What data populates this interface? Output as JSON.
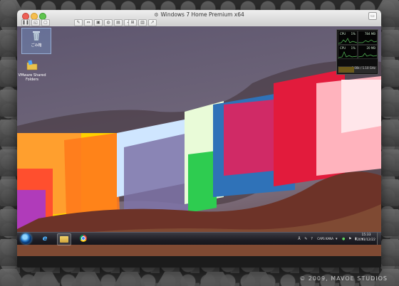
{
  "window": {
    "title": "Windows 7 Home Premium x64"
  },
  "desktop": {
    "icons": [
      {
        "label": "ごみ箱"
      },
      {
        "label": "VMware Shared Folders"
      }
    ]
  },
  "gadget": {
    "cpu_label": "CPU",
    "cpu_value": "1%",
    "mem_label": "784 MB",
    "cpu2_label": "CPU",
    "cpu2_value": "1%",
    "mem2_label": "20 MB",
    "freq": "0.00k / 1.10 GHz"
  },
  "taskbar": {
    "ime": "CAPS KANA",
    "time": "15:33",
    "date": "2013/12/22"
  },
  "watermark": {
    "text": "© 2009, MAVOE STUDIOS"
  }
}
